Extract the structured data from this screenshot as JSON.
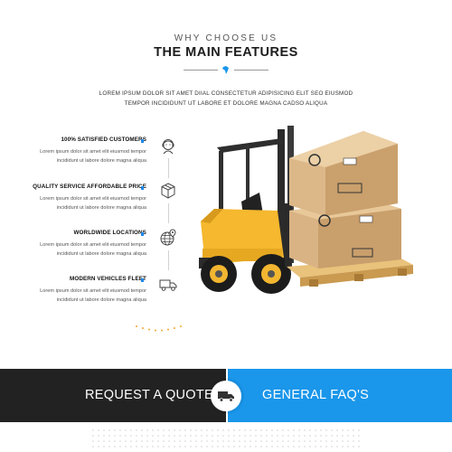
{
  "section": {
    "eyebrow": "WHY CHOOSE US",
    "title": "THE MAIN FEATURES",
    "intro_line1": "LOREM IPSUM DOLOR SIT AMET DIIAL CONSECTETUR ADIPISICING ELIT SEO EIUSMOD",
    "intro_line2": "TEMPOR INCIDIDUNT UT LABORE ET DOLORE MAGNA CADSO ALIQUA"
  },
  "features": [
    {
      "title": "100% SATISFIED CUSTOMERS",
      "desc_line1": "Lorem ipsum dolor sit amet elit eiusmod tempor",
      "desc_line2": "incididunt ut labore dolore magna aliqua",
      "icon": "customer-service-icon"
    },
    {
      "title": "QUALITY SERVICE AFFORDABLE PRICE",
      "desc_line1": "Lorem ipsum dolor sit amet elit eiusmod tempor",
      "desc_line2": "incididunt ut labore dolore magna aliqua",
      "icon": "package-icon"
    },
    {
      "title": "WORLDWIDE LOCATIONS",
      "desc_line1": "Lorem ipsum dolor sit amet elit eiusmod tempor",
      "desc_line2": "incididunt ut labore dolore magna aliqua",
      "icon": "globe-location-icon"
    },
    {
      "title": "MODERN VEHICLES FLEET",
      "desc_line1": "Lorem ipsum dolor sit amet elit eiusmod tempor",
      "desc_line2": "incididunt ut labore dolore magna aliqua",
      "icon": "delivery-truck-icon"
    }
  ],
  "cta": {
    "left_label": "REQUEST A QUOTE",
    "right_label": "GENERAL FAQ'S",
    "center_icon": "delivery-truck-icon"
  },
  "colors": {
    "accent": "#1a96ea",
    "dark": "#222222",
    "forklift_yellow": "#f5b82e",
    "dots_orange": "#f0a830"
  }
}
